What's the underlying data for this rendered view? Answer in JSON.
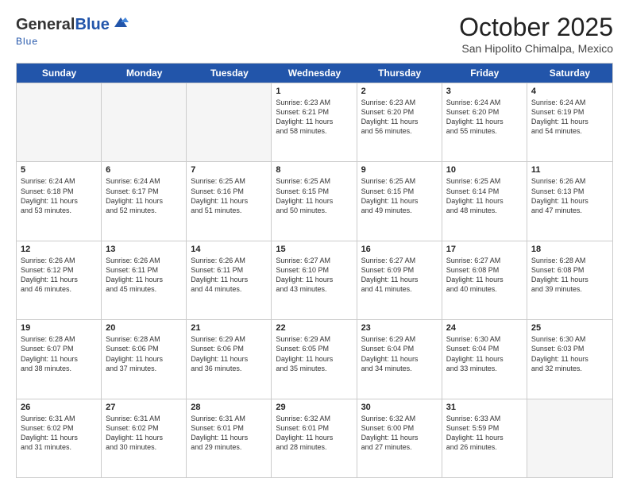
{
  "header": {
    "logo_general": "General",
    "logo_blue": "Blue",
    "month_title": "October 2025",
    "location": "San Hipolito Chimalpa, Mexico"
  },
  "weekdays": [
    "Sunday",
    "Monday",
    "Tuesday",
    "Wednesday",
    "Thursday",
    "Friday",
    "Saturday"
  ],
  "weeks": [
    [
      {
        "day": "",
        "empty": true
      },
      {
        "day": "",
        "empty": true
      },
      {
        "day": "",
        "empty": true
      },
      {
        "day": "1",
        "sunrise": "6:23 AM",
        "sunset": "6:21 PM",
        "daylight": "11 hours and 58 minutes."
      },
      {
        "day": "2",
        "sunrise": "6:23 AM",
        "sunset": "6:20 PM",
        "daylight": "11 hours and 56 minutes."
      },
      {
        "day": "3",
        "sunrise": "6:24 AM",
        "sunset": "6:20 PM",
        "daylight": "11 hours and 55 minutes."
      },
      {
        "day": "4",
        "sunrise": "6:24 AM",
        "sunset": "6:19 PM",
        "daylight": "11 hours and 54 minutes."
      }
    ],
    [
      {
        "day": "5",
        "sunrise": "6:24 AM",
        "sunset": "6:18 PM",
        "daylight": "11 hours and 53 minutes."
      },
      {
        "day": "6",
        "sunrise": "6:24 AM",
        "sunset": "6:17 PM",
        "daylight": "11 hours and 52 minutes."
      },
      {
        "day": "7",
        "sunrise": "6:25 AM",
        "sunset": "6:16 PM",
        "daylight": "11 hours and 51 minutes."
      },
      {
        "day": "8",
        "sunrise": "6:25 AM",
        "sunset": "6:15 PM",
        "daylight": "11 hours and 50 minutes."
      },
      {
        "day": "9",
        "sunrise": "6:25 AM",
        "sunset": "6:15 PM",
        "daylight": "11 hours and 49 minutes."
      },
      {
        "day": "10",
        "sunrise": "6:25 AM",
        "sunset": "6:14 PM",
        "daylight": "11 hours and 48 minutes."
      },
      {
        "day": "11",
        "sunrise": "6:26 AM",
        "sunset": "6:13 PM",
        "daylight": "11 hours and 47 minutes."
      }
    ],
    [
      {
        "day": "12",
        "sunrise": "6:26 AM",
        "sunset": "6:12 PM",
        "daylight": "11 hours and 46 minutes."
      },
      {
        "day": "13",
        "sunrise": "6:26 AM",
        "sunset": "6:11 PM",
        "daylight": "11 hours and 45 minutes."
      },
      {
        "day": "14",
        "sunrise": "6:26 AM",
        "sunset": "6:11 PM",
        "daylight": "11 hours and 44 minutes."
      },
      {
        "day": "15",
        "sunrise": "6:27 AM",
        "sunset": "6:10 PM",
        "daylight": "11 hours and 43 minutes."
      },
      {
        "day": "16",
        "sunrise": "6:27 AM",
        "sunset": "6:09 PM",
        "daylight": "11 hours and 41 minutes."
      },
      {
        "day": "17",
        "sunrise": "6:27 AM",
        "sunset": "6:08 PM",
        "daylight": "11 hours and 40 minutes."
      },
      {
        "day": "18",
        "sunrise": "6:28 AM",
        "sunset": "6:08 PM",
        "daylight": "11 hours and 39 minutes."
      }
    ],
    [
      {
        "day": "19",
        "sunrise": "6:28 AM",
        "sunset": "6:07 PM",
        "daylight": "11 hours and 38 minutes."
      },
      {
        "day": "20",
        "sunrise": "6:28 AM",
        "sunset": "6:06 PM",
        "daylight": "11 hours and 37 minutes."
      },
      {
        "day": "21",
        "sunrise": "6:29 AM",
        "sunset": "6:06 PM",
        "daylight": "11 hours and 36 minutes."
      },
      {
        "day": "22",
        "sunrise": "6:29 AM",
        "sunset": "6:05 PM",
        "daylight": "11 hours and 35 minutes."
      },
      {
        "day": "23",
        "sunrise": "6:29 AM",
        "sunset": "6:04 PM",
        "daylight": "11 hours and 34 minutes."
      },
      {
        "day": "24",
        "sunrise": "6:30 AM",
        "sunset": "6:04 PM",
        "daylight": "11 hours and 33 minutes."
      },
      {
        "day": "25",
        "sunrise": "6:30 AM",
        "sunset": "6:03 PM",
        "daylight": "11 hours and 32 minutes."
      }
    ],
    [
      {
        "day": "26",
        "sunrise": "6:31 AM",
        "sunset": "6:02 PM",
        "daylight": "11 hours and 31 minutes."
      },
      {
        "day": "27",
        "sunrise": "6:31 AM",
        "sunset": "6:02 PM",
        "daylight": "11 hours and 30 minutes."
      },
      {
        "day": "28",
        "sunrise": "6:31 AM",
        "sunset": "6:01 PM",
        "daylight": "11 hours and 29 minutes."
      },
      {
        "day": "29",
        "sunrise": "6:32 AM",
        "sunset": "6:01 PM",
        "daylight": "11 hours and 28 minutes."
      },
      {
        "day": "30",
        "sunrise": "6:32 AM",
        "sunset": "6:00 PM",
        "daylight": "11 hours and 27 minutes."
      },
      {
        "day": "31",
        "sunrise": "6:33 AM",
        "sunset": "5:59 PM",
        "daylight": "11 hours and 26 minutes."
      },
      {
        "day": "",
        "empty": true
      }
    ]
  ],
  "labels": {
    "sunrise": "Sunrise:",
    "sunset": "Sunset:",
    "daylight": "Daylight:"
  }
}
